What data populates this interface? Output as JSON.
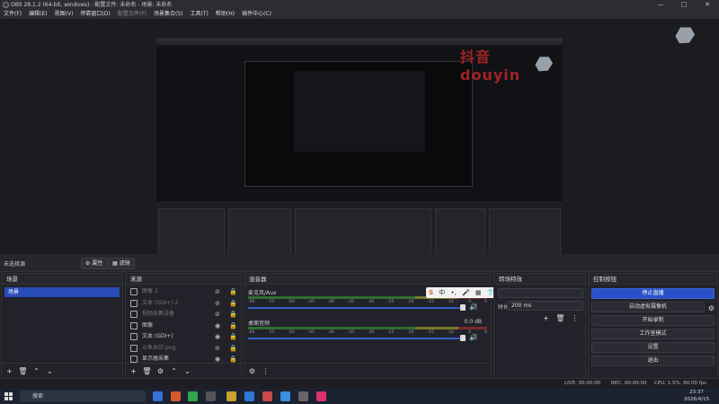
{
  "window": {
    "title": "OBS 28.1.2 (64-bit, windows) - 配置文件: 未命名 - 场景: 未命名",
    "controls": [
      "—",
      "□",
      "✕"
    ]
  },
  "menu": {
    "items": [
      "文件(F)",
      "编辑(E)",
      "视图(V)",
      "停靠窗口(D)",
      "配置文件(P)",
      "场景集合(S)",
      "工具(T)",
      "帮助(H)",
      "插件中心(C)"
    ]
  },
  "watermark": {
    "text": "抖音 douyin"
  },
  "scene_status": {
    "label": "未选择源",
    "properties_label": "属性",
    "filters_label": "滤镜"
  },
  "scenes": {
    "title": "场景",
    "items": [
      {
        "label": "场景"
      }
    ]
  },
  "sources": {
    "title": "来源",
    "items": [
      {
        "label": "图像 2",
        "dim": true
      },
      {
        "label": "文本 (GDI+) 2",
        "dim": true
      },
      {
        "label": "视频采集设备",
        "dim": true
      },
      {
        "label": "图像",
        "dim": false
      },
      {
        "label": "文本 (GDI+)",
        "dim": false
      },
      {
        "label": "斗鱼水印.png",
        "dim": true
      },
      {
        "label": "显示器采集",
        "dim": false
      }
    ]
  },
  "mixer": {
    "title": "混音器",
    "channels": [
      {
        "name": "麦克风/Aux",
        "db": "0.0 dB",
        "ticks": [
          "-60",
          "-55",
          "-50",
          "-45",
          "-40",
          "-35",
          "-30",
          "-25",
          "-20",
          "-15",
          "-10",
          "-5",
          "0"
        ]
      },
      {
        "name": "桌面音频",
        "db": "0.0 dB",
        "ticks": [
          "-60",
          "-55",
          "-50",
          "-45",
          "-40",
          "-35",
          "-30",
          "-25",
          "-20",
          "-15",
          "-10",
          "-5",
          "0"
        ]
      }
    ]
  },
  "floating_toolbar": {
    "items": [
      "S",
      "中",
      "•,",
      "🎤",
      "▦",
      "👕",
      "☷",
      "✂"
    ]
  },
  "transitions": {
    "title": "转场特效",
    "duration_label": "时长",
    "duration_value": "200 ms"
  },
  "controls": {
    "title": "控制按钮",
    "buttons": [
      "停止直播",
      "启动虚拟摄像机",
      "开始录制",
      "工作室模式",
      "设置",
      "退出"
    ]
  },
  "status_bar": {
    "live": "LIVE: 00:00:00",
    "rec": "REC: 00:00:00",
    "cpu": "CPU: 1.5%, 60.00 fps"
  },
  "taskbar": {
    "search_placeholder": "搜索",
    "time": "23:37",
    "date": "2026/4/15"
  },
  "colors": {
    "accent": "#284cb8",
    "primary_button": "#2a52c8",
    "meter_green": "#2f6d2f"
  }
}
